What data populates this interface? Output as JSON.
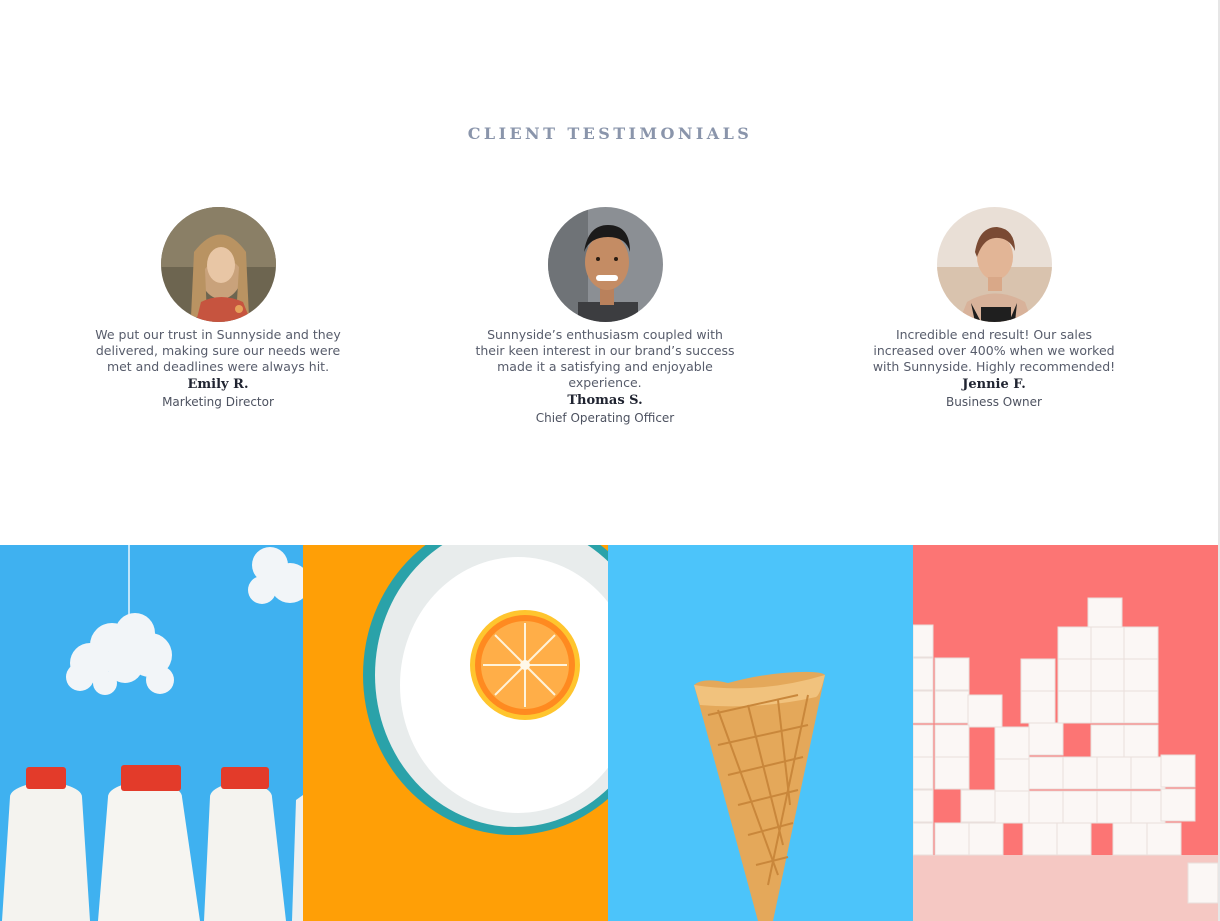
{
  "section": {
    "title": "CLIENT TESTIMONIALS"
  },
  "testimonials": [
    {
      "quote": "We put our trust in Sunnyside and they delivered, making sure our needs were met and deadlines were always hit.",
      "name": "Emily R.",
      "role": "Marketing Director"
    },
    {
      "quote": "Sunnyside’s enthusiasm coupled with their keen interest in our brand’s success made it a satisfying and enjoyable experience.",
      "name": "Thomas S.",
      "role": "Chief Operating Officer"
    },
    {
      "quote": "Incredible end result! Our sales increased over 400% when we worked with Sunnyside. Highly recommended!",
      "name": "Jennie F.",
      "role": "Business Owner"
    }
  ],
  "gallery": {
    "tiles": [
      "milk-bottles",
      "orange-on-plate",
      "ice-cream-cone",
      "sugar-cubes"
    ]
  },
  "colors": {
    "title": "#8a95ab",
    "name": "#202431",
    "body": "#575c6b",
    "milk_bg": "#3fb1f0",
    "orange_bg": "#ff9f06",
    "cone_bg": "#4cc4fa",
    "sugar_bg": "#fc7574"
  }
}
